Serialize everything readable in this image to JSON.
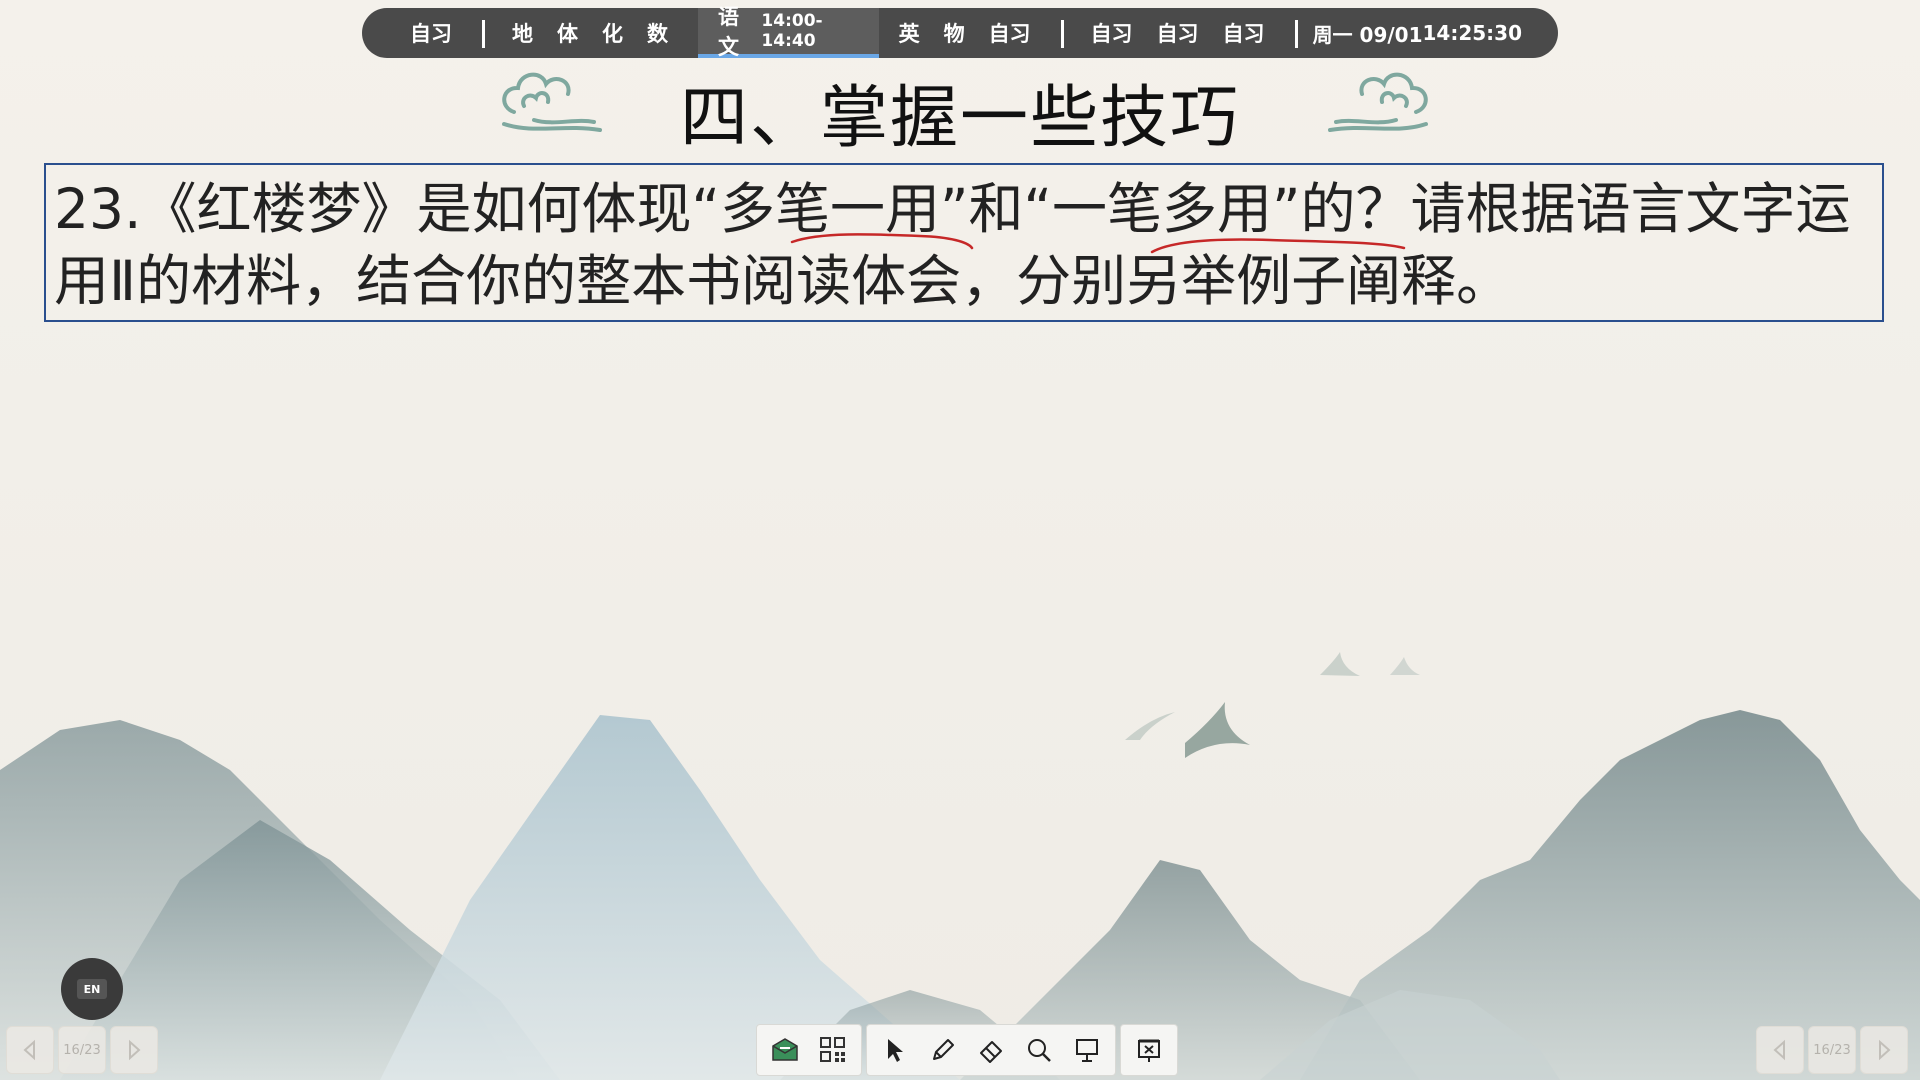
{
  "schedule": {
    "group1": [
      "自习"
    ],
    "group2": [
      "地",
      "体",
      "化",
      "数"
    ],
    "current": {
      "subject": "语文",
      "time": "14:00-14:40"
    },
    "group3": [
      "英",
      "物",
      "自习"
    ],
    "group4": [
      "自习",
      "自习",
      "自习"
    ],
    "date": "周一 09/01",
    "clock": "14:25:30"
  },
  "slide": {
    "title": "四、掌握一些技巧",
    "question": "23.《红楼梦》是如何体现“多笔一用”和“一笔多用”的？请根据语言文字运用Ⅱ的材料，结合你的整本书阅读体会，分别另举例子阐释。"
  },
  "en_button": {
    "label": "EN"
  },
  "pager_left": {
    "page": "16/23"
  },
  "pager_right": {
    "page": "16/23"
  },
  "toolbar": {
    "tools": [
      "class-icon",
      "apps-grid-icon",
      "pointer-icon",
      "pen-icon",
      "eraser-icon",
      "search-icon",
      "screen-icon",
      "exit-slideshow-icon"
    ]
  },
  "colors": {
    "bar_bg": "#4a4a4a",
    "accent_blue": "#6aa7e6",
    "box_border": "#2a4f8e",
    "underline_red": "#c62828"
  }
}
